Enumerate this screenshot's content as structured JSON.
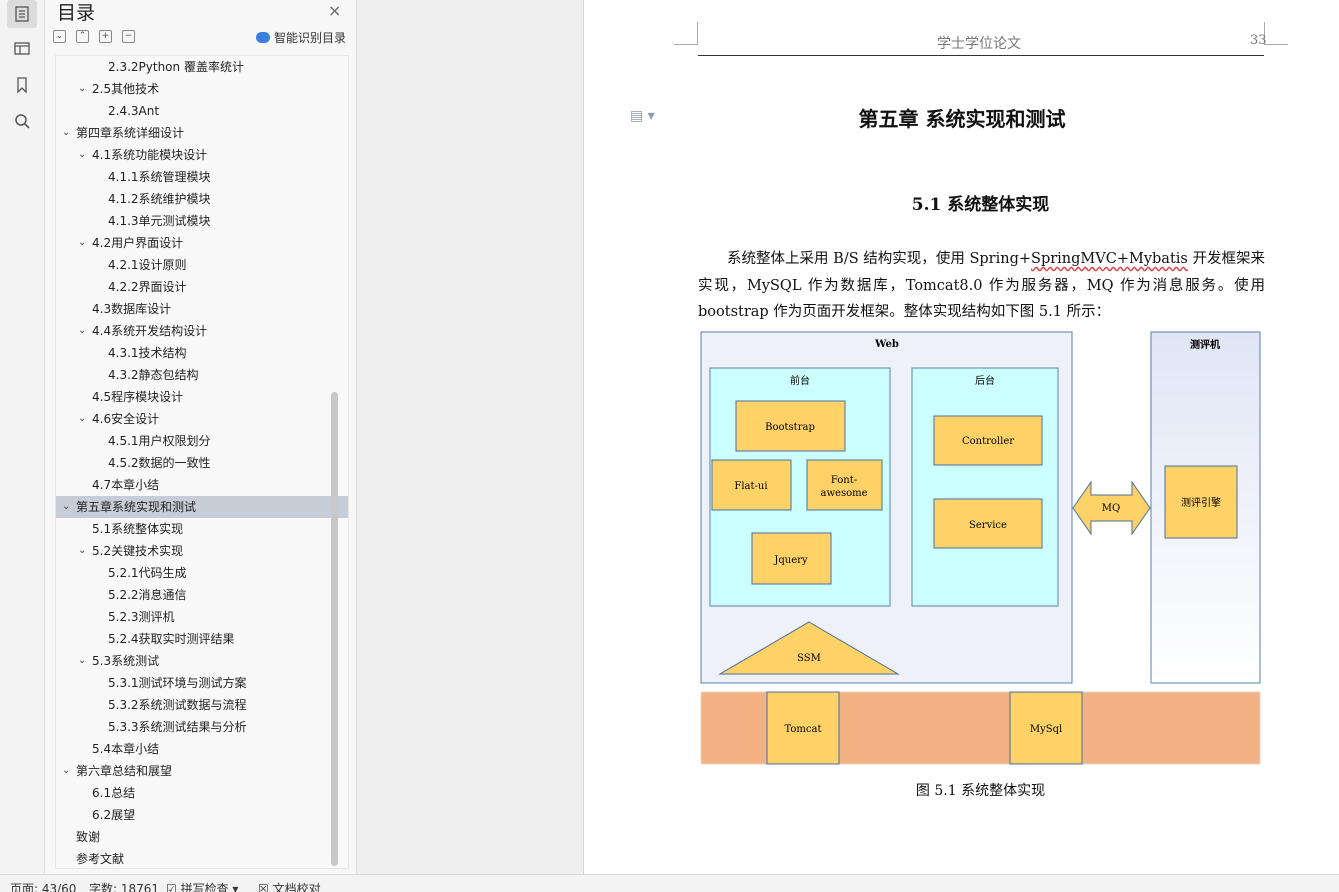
{
  "toc": {
    "title": "目录",
    "smart_label": "智能识别目录",
    "close_glyph": "×",
    "items": [
      {
        "label": "2.3.2Python 覆盖率统计",
        "level": 3,
        "expanded": null,
        "selected": false
      },
      {
        "label": "2.5其他技术",
        "level": 2,
        "expanded": true,
        "selected": false
      },
      {
        "label": "2.4.3Ant",
        "level": 3,
        "expanded": null,
        "selected": false
      },
      {
        "label": "第四章系统详细设计",
        "level": 1,
        "expanded": true,
        "selected": false
      },
      {
        "label": "4.1系统功能模块设计",
        "level": 2,
        "expanded": true,
        "selected": false
      },
      {
        "label": "4.1.1系统管理模块",
        "level": 3,
        "expanded": null,
        "selected": false
      },
      {
        "label": "4.1.2系统维护模块",
        "level": 3,
        "expanded": null,
        "selected": false
      },
      {
        "label": "4.1.3单元测试模块",
        "level": 3,
        "expanded": null,
        "selected": false
      },
      {
        "label": "4.2用户界面设计",
        "level": 2,
        "expanded": true,
        "selected": false
      },
      {
        "label": "4.2.1设计原则",
        "level": 3,
        "expanded": null,
        "selected": false
      },
      {
        "label": "4.2.2界面设计",
        "level": 3,
        "expanded": null,
        "selected": false
      },
      {
        "label": "4.3数据库设计",
        "level": 2,
        "expanded": null,
        "selected": false
      },
      {
        "label": "4.4系统开发结构设计",
        "level": 2,
        "expanded": true,
        "selected": false
      },
      {
        "label": "4.3.1技术结构",
        "level": 3,
        "expanded": null,
        "selected": false
      },
      {
        "label": "4.3.2静态包结构",
        "level": 3,
        "expanded": null,
        "selected": false
      },
      {
        "label": "4.5程序模块设计",
        "level": 2,
        "expanded": null,
        "selected": false
      },
      {
        "label": "4.6安全设计",
        "level": 2,
        "expanded": true,
        "selected": false
      },
      {
        "label": "4.5.1用户权限划分",
        "level": 3,
        "expanded": null,
        "selected": false
      },
      {
        "label": "4.5.2数据的一致性",
        "level": 3,
        "expanded": null,
        "selected": false
      },
      {
        "label": "4.7本章小结",
        "level": 2,
        "expanded": null,
        "selected": false
      },
      {
        "label": "第五章系统实现和测试",
        "level": 1,
        "expanded": true,
        "selected": true
      },
      {
        "label": "5.1系统整体实现",
        "level": 2,
        "expanded": null,
        "selected": false
      },
      {
        "label": "5.2关键技术实现",
        "level": 2,
        "expanded": true,
        "selected": false
      },
      {
        "label": "5.2.1代码生成",
        "level": 3,
        "expanded": null,
        "selected": false
      },
      {
        "label": "5.2.2消息通信",
        "level": 3,
        "expanded": null,
        "selected": false
      },
      {
        "label": "5.2.3测评机",
        "level": 3,
        "expanded": null,
        "selected": false
      },
      {
        "label": "5.2.4获取实时测评结果",
        "level": 3,
        "expanded": null,
        "selected": false
      },
      {
        "label": "5.3系统测试",
        "level": 2,
        "expanded": true,
        "selected": false
      },
      {
        "label": "5.3.1测试环境与测试方案",
        "level": 3,
        "expanded": null,
        "selected": false
      },
      {
        "label": "5.3.2系统测试数据与流程",
        "level": 3,
        "expanded": null,
        "selected": false
      },
      {
        "label": "5.3.3系统测试结果与分析",
        "level": 3,
        "expanded": null,
        "selected": false
      },
      {
        "label": "5.4本章小结",
        "level": 2,
        "expanded": null,
        "selected": false
      },
      {
        "label": "第六章总结和展望",
        "level": 1,
        "expanded": true,
        "selected": false
      },
      {
        "label": "6.1总结",
        "level": 2,
        "expanded": null,
        "selected": false
      },
      {
        "label": "6.2展望",
        "level": 2,
        "expanded": null,
        "selected": false
      },
      {
        "label": "致谢",
        "level": 1,
        "expanded": null,
        "selected": false
      },
      {
        "label": "参考文献",
        "level": 1,
        "expanded": null,
        "selected": false
      }
    ]
  },
  "document": {
    "header_text": "学士学位论文",
    "page_number": "33",
    "chapter_title": "第五章  系统实现和测试",
    "section_title": "5.1  系统整体实现",
    "paragraph_indent": "系统整体上采用 B/S 结构实现，使用 Spring+",
    "paragraph_wavy": "SpringMVC+Mybatis",
    "paragraph_rest": " 开发框架来实现，MySQL 作为数据库，Tomcat8.0 作为服务器，MQ 作为消息服务。使用 bootstrap 作为页面开发框架。整体实现结构如下图 5.1 所示：",
    "figure_caption": "图 5.1  系统整体实现",
    "diagram": {
      "web": "Web",
      "front": "前台",
      "back": "后台",
      "judge": "测评机",
      "bootstrap": "Bootstrap",
      "flatui": "Flat-ui",
      "fontawesome_1": "Font-",
      "fontawesome_2": "awesome",
      "jquery": "Jquery",
      "controller": "Controller",
      "service": "Service",
      "mq": "MQ",
      "engine": "测评引擎",
      "ssm": "SSM",
      "tomcat": "Tomcat",
      "mysql": "MySql",
      "colors": {
        "box": "#fed267",
        "panel": "#ccffff",
        "outer": "#e8ecf6",
        "base": "#f4b183",
        "border": "#4a6fa0"
      }
    }
  },
  "status": {
    "page": "页面: 43/60",
    "words": "字数: 18761",
    "spell": "拼写检查",
    "proof": "文档校对"
  }
}
